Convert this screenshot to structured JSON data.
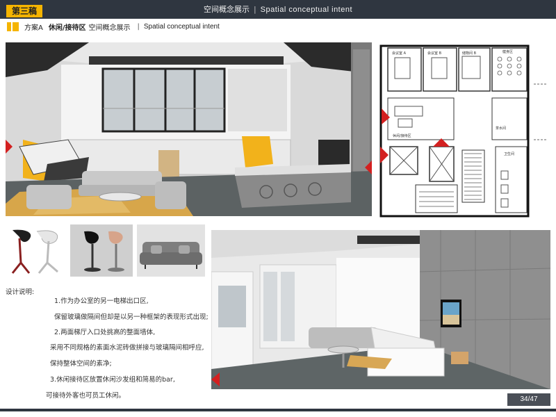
{
  "header": {
    "draft_label": "第三稿",
    "title_cn": "空间概念展示",
    "title_sep": "|",
    "title_en": "Spatial conceptual intent"
  },
  "subheader": {
    "scheme": "方案A",
    "area": "休闲/接待区",
    "title_cn": "空间概念展示",
    "sep": "|",
    "title_en": "Spatial conceptual intent"
  },
  "floorplan": {
    "rooms": [
      "会议室 A",
      "会议室 B",
      "储物间 B",
      "休闲/接待区",
      "茶水间",
      "卫生间",
      "健身区"
    ]
  },
  "description": {
    "heading": "设计说明:",
    "lines": [
      "1.作为办公室的另一电梯出口区,",
      "保留玻璃做隔间但却是以另一种框架的表现形式出现;",
      "2.两面梯厅入口处挑高的整面墙体,",
      "采用不同规格的素面水泥砖做拼接与玻璃隔间相呼应,",
      "保持整体空间的素净;",
      "3.休闲接待区放置休闲沙发组和简易的bar,",
      "可接待外客也可员工休闲。"
    ]
  },
  "page_number": "34/47",
  "colors": {
    "accent": "#f5b400",
    "dark": "#2f3640",
    "marker": "#d32020"
  }
}
